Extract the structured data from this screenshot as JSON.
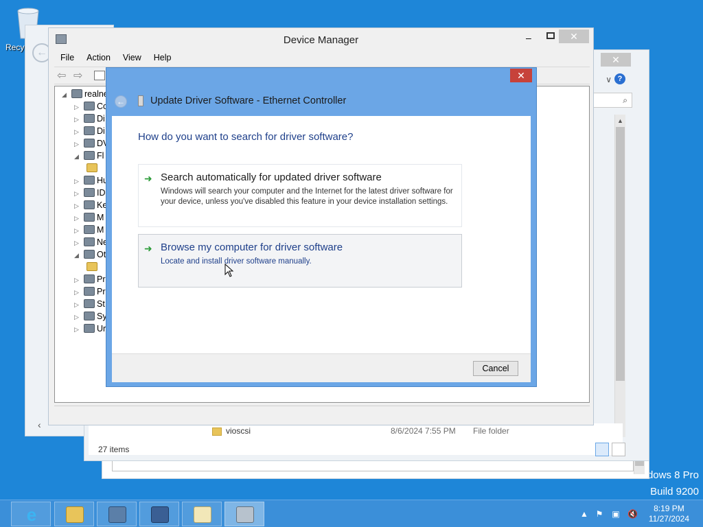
{
  "desktop": {
    "recycle_label": "Recyc",
    "watermark_line1": "dows 8 Pro",
    "watermark_line2": "Build 9200"
  },
  "device_manager": {
    "title": "Device Manager",
    "menu": [
      "File",
      "Action",
      "View",
      "Help"
    ],
    "tree_root": "realne",
    "tree_items": [
      {
        "arrow": "▷",
        "label": "Co"
      },
      {
        "arrow": "▷",
        "label": "Di"
      },
      {
        "arrow": "▷",
        "label": "Di"
      },
      {
        "arrow": "▷",
        "label": "DV"
      },
      {
        "arrow": "◢",
        "label": "Fl"
      },
      {
        "arrow": "",
        "label": ""
      },
      {
        "arrow": "▷",
        "label": "Hu"
      },
      {
        "arrow": "▷",
        "label": "ID"
      },
      {
        "arrow": "▷",
        "label": "Ke"
      },
      {
        "arrow": "▷",
        "label": "M"
      },
      {
        "arrow": "▷",
        "label": "M"
      },
      {
        "arrow": "▷",
        "label": "Ne"
      },
      {
        "arrow": "◢",
        "label": "Ot"
      },
      {
        "arrow": "",
        "label": ""
      },
      {
        "arrow": "▷",
        "label": "Pr"
      },
      {
        "arrow": "▷",
        "label": "Pr"
      },
      {
        "arrow": "▷",
        "label": "St"
      },
      {
        "arrow": "▷",
        "label": "Sy"
      },
      {
        "arrow": "▷",
        "label": "Ur"
      }
    ]
  },
  "explorer": {
    "search_placeholder": "",
    "row": {
      "name": "vioscsi",
      "date": "8/6/2024 7:55 PM",
      "type": "File folder"
    },
    "item_count": "27 items"
  },
  "dialog": {
    "title": "Update Driver Software - Ethernet Controller",
    "question": "How do you want to search for driver software?",
    "options": [
      {
        "heading": "Search automatically for updated driver software",
        "description": "Windows will search your computer and the Internet for the latest driver software for your device, unless you've disabled this feature in your device installation settings."
      },
      {
        "heading": "Browse my computer for driver software",
        "description": "Locate and install driver software manually."
      }
    ],
    "cancel_label": "Cancel",
    "close_symbol": "✕"
  },
  "taskbar": {
    "apps": [
      "internet-explorer",
      "file-explorer",
      "server-manager",
      "remote-desktop",
      "notepad",
      "device-manager"
    ],
    "time": "8:19 PM",
    "date": "11/27/2024"
  },
  "colors": {
    "desktop": "#1e86d8",
    "dialog_frame": "#6ba6e6",
    "close_red": "#c7423a",
    "link_blue": "#1e3f8a",
    "arrow_green": "#2b9b38"
  }
}
